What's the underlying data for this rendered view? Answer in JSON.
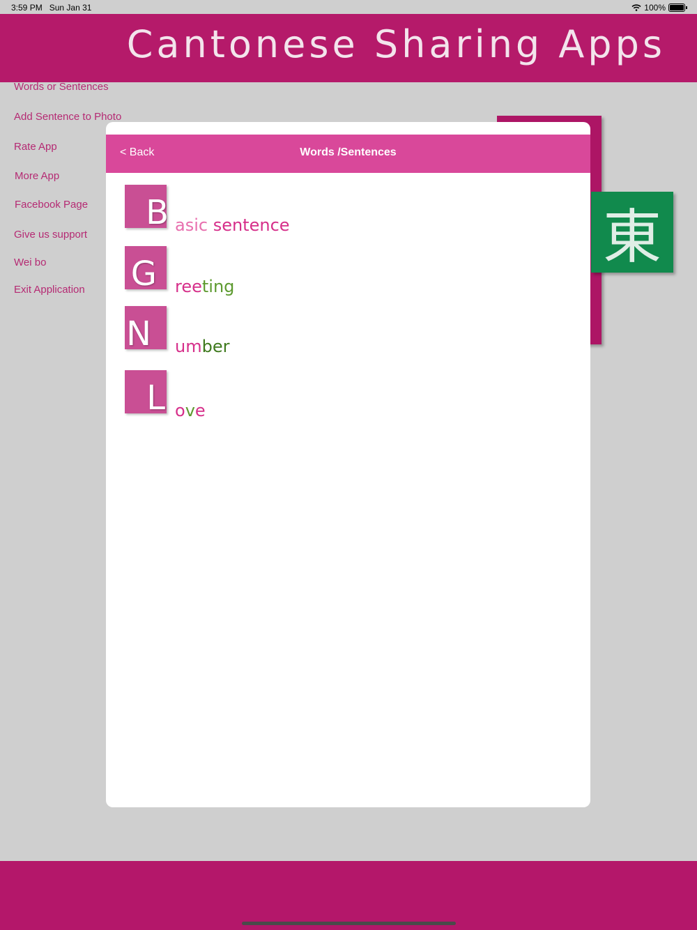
{
  "status_bar": {
    "time": "3:59 PM",
    "date": "Sun Jan 31",
    "battery": "100%"
  },
  "header": {
    "title": "Cantonese Sharing Apps"
  },
  "menu": {
    "items": [
      "Words or Sentences",
      "Add Sentence to Photo",
      "Rate App",
      "More App",
      "Facebook Page",
      "Give us support",
      "Wei bo",
      "Exit Application"
    ]
  },
  "decoration": {
    "chinese_character": "東"
  },
  "modal": {
    "back_label": "< Back",
    "title": "Words /Sentences",
    "items": [
      {
        "letter": "B",
        "parts": [
          {
            "text": "asic ",
            "color": "#e86fae"
          },
          {
            "text": "sentence",
            "color": "#d62f8a"
          }
        ]
      },
      {
        "letter": "G",
        "parts": [
          {
            "text": "ree",
            "color": "#d62f8a"
          },
          {
            "text": "ting",
            "color": "#5d9a2f"
          }
        ]
      },
      {
        "letter": "N",
        "parts": [
          {
            "text": "um",
            "color": "#d62f8a"
          },
          {
            "text": "ber",
            "color": "#3f7a1e"
          }
        ]
      },
      {
        "letter": "L",
        "parts": [
          {
            "text": "o",
            "color": "#d62f8a"
          },
          {
            "text": "v",
            "color": "#5d9a2f"
          },
          {
            "text": "e",
            "color": "#d62f8a"
          }
        ]
      }
    ]
  },
  "colors": {
    "brand_magenta": "#b51a6a",
    "modal_header": "#d9489a",
    "green_tile": "#118a4d"
  }
}
